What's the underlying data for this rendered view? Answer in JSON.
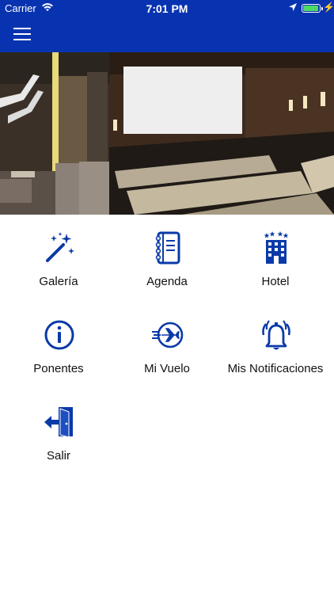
{
  "status_bar": {
    "carrier": "Carrier",
    "time": "7:01 PM",
    "battery_level": 0.95
  },
  "nav": {
    "menu_icon": "hamburger-icon"
  },
  "carousel": {
    "slides": 5,
    "active_slide": 5
  },
  "menu": [
    {
      "label": "Galería",
      "icon": "magic-wand-icon"
    },
    {
      "label": "Agenda",
      "icon": "notebook-icon"
    },
    {
      "label": "Hotel",
      "icon": "hotel-icon"
    },
    {
      "label": "Ponentes",
      "icon": "info-icon"
    },
    {
      "label": "Mi Vuelo",
      "icon": "airplane-icon"
    },
    {
      "label": "Mis Notificaciones",
      "icon": "bell-icon"
    },
    {
      "label": "Salir",
      "icon": "exit-door-icon"
    }
  ],
  "colors": {
    "brand": "#0833b0",
    "icon": "#0a3aa8",
    "dot_active": "#0a2fb5"
  }
}
